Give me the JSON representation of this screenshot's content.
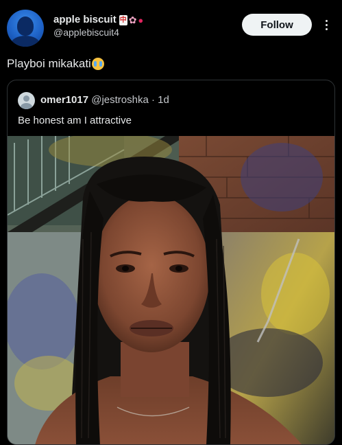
{
  "author": {
    "display_name": "apple biscuit",
    "name_emojis": [
      "mahjong-red-dragon-emoji",
      "cherry-blossom-emoji",
      "lips-emoji"
    ],
    "handle": "@applebiscuit4"
  },
  "follow_button": {
    "label": "Follow"
  },
  "more_icon": "more-vertical-icon",
  "post": {
    "text": "Playboi mikakati",
    "emoji": "crying-face-emoji"
  },
  "quote": {
    "name": "omer1017",
    "handle": "@jestroshka",
    "separator": "·",
    "time": "1d",
    "text": "Be honest am I attractive"
  },
  "colors": {
    "background": "#000000",
    "text_primary": "#e7e9ea",
    "text_secondary": "#c5c8cc",
    "border": "#2f3336",
    "follow_bg": "#eff3f4"
  }
}
